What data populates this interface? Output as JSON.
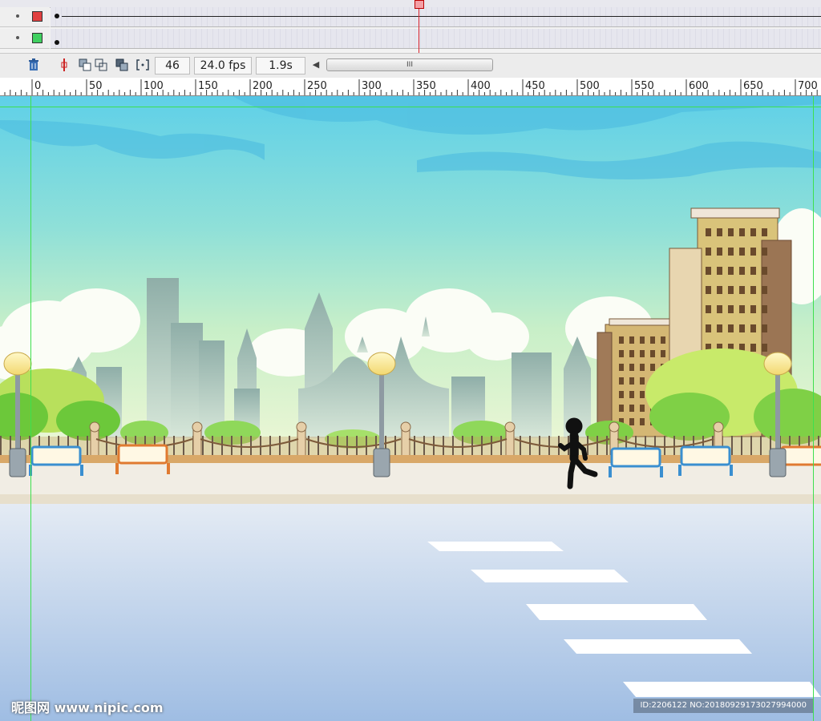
{
  "timeline": {
    "layers": [
      {
        "color": "#e04040",
        "has_tween": true
      },
      {
        "color": "#40d060",
        "has_tween": false
      }
    ],
    "controls": {
      "trash_icon": "trash-icon",
      "current_frame": "46",
      "frame_rate": "24.0 fps",
      "elapsed_time": "1.9s",
      "scroll_thumb_label": "III",
      "scroll_left_arrow": "◀"
    }
  },
  "ruler": {
    "labels": [
      "0",
      "50",
      "100",
      "150",
      "200",
      "250",
      "300",
      "350",
      "400",
      "450",
      "500",
      "550",
      "600",
      "650",
      "700"
    ]
  },
  "colors": {
    "playhead": "#d9232d",
    "guide": "#3ee04e",
    "sky_top": "#5fd0e8",
    "sky_bottom": "#e8f6d0",
    "road_top": "#dfe8f2",
    "road_bottom": "#9fbde3"
  },
  "watermark": {
    "left": "昵图网 www.nipic.com",
    "right": "ID:2206122 NO:20180929173027994000"
  }
}
